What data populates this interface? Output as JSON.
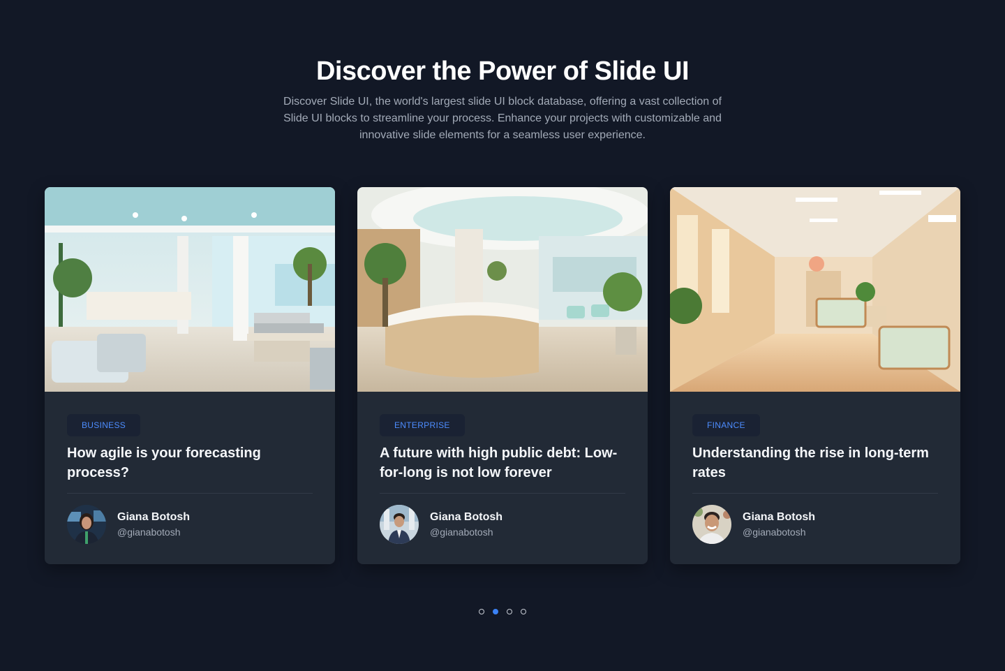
{
  "header": {
    "title": "Discover the Power of Slide UI",
    "description": "Discover Slide UI, the world's largest slide UI block database, offering a vast collection of Slide UI blocks to streamline your process. Enhance your projects with customizable and innovative slide elements for a seamless user experience."
  },
  "cards": [
    {
      "image": "office-lobby-interior-photo",
      "tag": "BUSINESS",
      "title": "How agile is your forecasting process?",
      "author": {
        "name": "Giana Botosh",
        "handle": "@gianabotosh",
        "avatar": "woman-avatar-photo"
      }
    },
    {
      "image": "reception-lobby-interior-photo",
      "tag": "ENTERPRISE",
      "title": "A future with high public debt: Low-for-long is not low forever",
      "author": {
        "name": "Giana Botosh",
        "handle": "@gianabotosh",
        "avatar": "man-suit-avatar-photo"
      }
    },
    {
      "image": "hospital-corridor-interior-photo",
      "tag": "FINANCE",
      "title": "Understanding the rise in long-term rates",
      "author": {
        "name": "Giana Botosh",
        "handle": "@gianabotosh",
        "avatar": "smiling-man-avatar-photo"
      }
    }
  ],
  "carousel": {
    "total_slides": 4,
    "active_index": 1
  },
  "colors": {
    "background": "#121826",
    "card": "#222a36",
    "accent": "#3b82f6",
    "tag_text": "#4d8dff"
  }
}
